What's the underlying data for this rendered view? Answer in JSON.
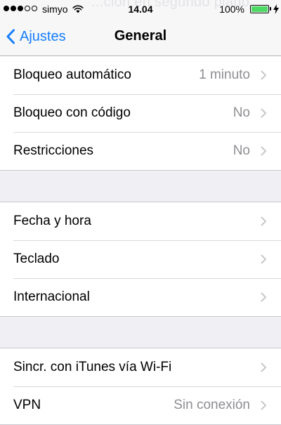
{
  "status_bar": {
    "ghost_text": "...ción en segundo plano",
    "signal_dots_filled": 3,
    "signal_dots_total": 5,
    "carrier": "simyo",
    "time": "14.04",
    "battery_percent": "100%",
    "battery_level": 1.0,
    "battery_color": "#4cd964",
    "charging": true
  },
  "nav": {
    "back_label": "Ajustes",
    "title": "General",
    "accent_color": "#157efb"
  },
  "groups": [
    {
      "rows": [
        {
          "label": "Bloqueo automático",
          "value": "1 minuto"
        },
        {
          "label": "Bloqueo con código",
          "value": "No"
        },
        {
          "label": "Restricciones",
          "value": "No"
        }
      ]
    },
    {
      "rows": [
        {
          "label": "Fecha y hora",
          "value": ""
        },
        {
          "label": "Teclado",
          "value": ""
        },
        {
          "label": "Internacional",
          "value": ""
        }
      ]
    },
    {
      "rows": [
        {
          "label": "Sincr. con iTunes vía Wi-Fi",
          "value": ""
        },
        {
          "label": "VPN",
          "value": "Sin conexión"
        }
      ]
    }
  ]
}
